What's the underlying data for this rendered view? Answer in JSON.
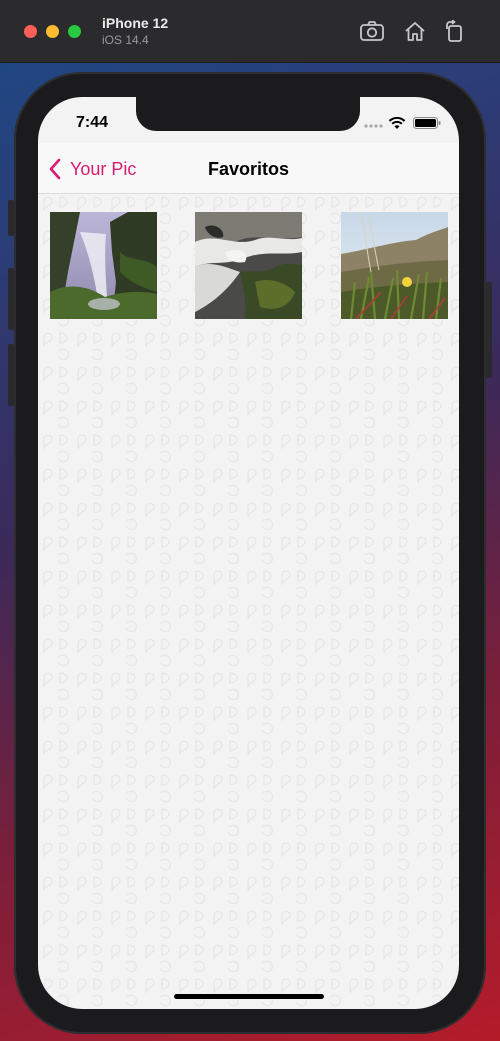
{
  "simulator": {
    "device_name": "iPhone 12",
    "os_version": "iOS 14.4",
    "tools": [
      "camera-icon",
      "home-icon",
      "rotate-icon"
    ]
  },
  "status_bar": {
    "time": "7:44"
  },
  "navbar": {
    "back_label": "Your Pic",
    "title": "Favoritos",
    "accent_color": "#d81b72"
  },
  "favorites": [
    {
      "subject": "waterfall"
    },
    {
      "subject": "stream"
    },
    {
      "subject": "wildflower"
    }
  ]
}
